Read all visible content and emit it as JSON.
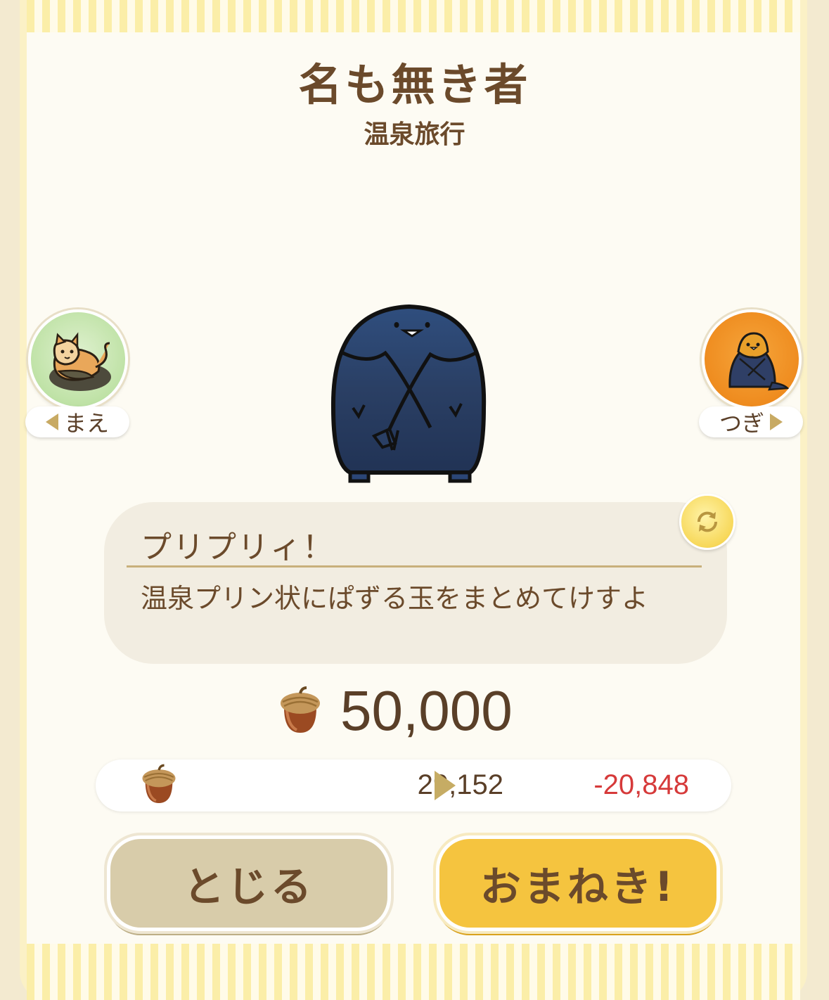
{
  "header": {
    "title": "名も無き者",
    "subtitle": "温泉旅行"
  },
  "nav": {
    "prev_label": "まえ",
    "next_label": "つぎ"
  },
  "description": {
    "title": "プリプリィ！",
    "text": "温泉プリン状にぱずる玉をまとめてけすよ"
  },
  "price": {
    "value": "50,000",
    "icon": "acorn-icon"
  },
  "balance": {
    "current": "29,152",
    "after": "-20,848",
    "after_color": "#d63a3a"
  },
  "buttons": {
    "close_label": "とじる",
    "invite_label": "おまねき!"
  },
  "colors": {
    "accent": "#f5c43f",
    "text": "#6b4a2b"
  }
}
